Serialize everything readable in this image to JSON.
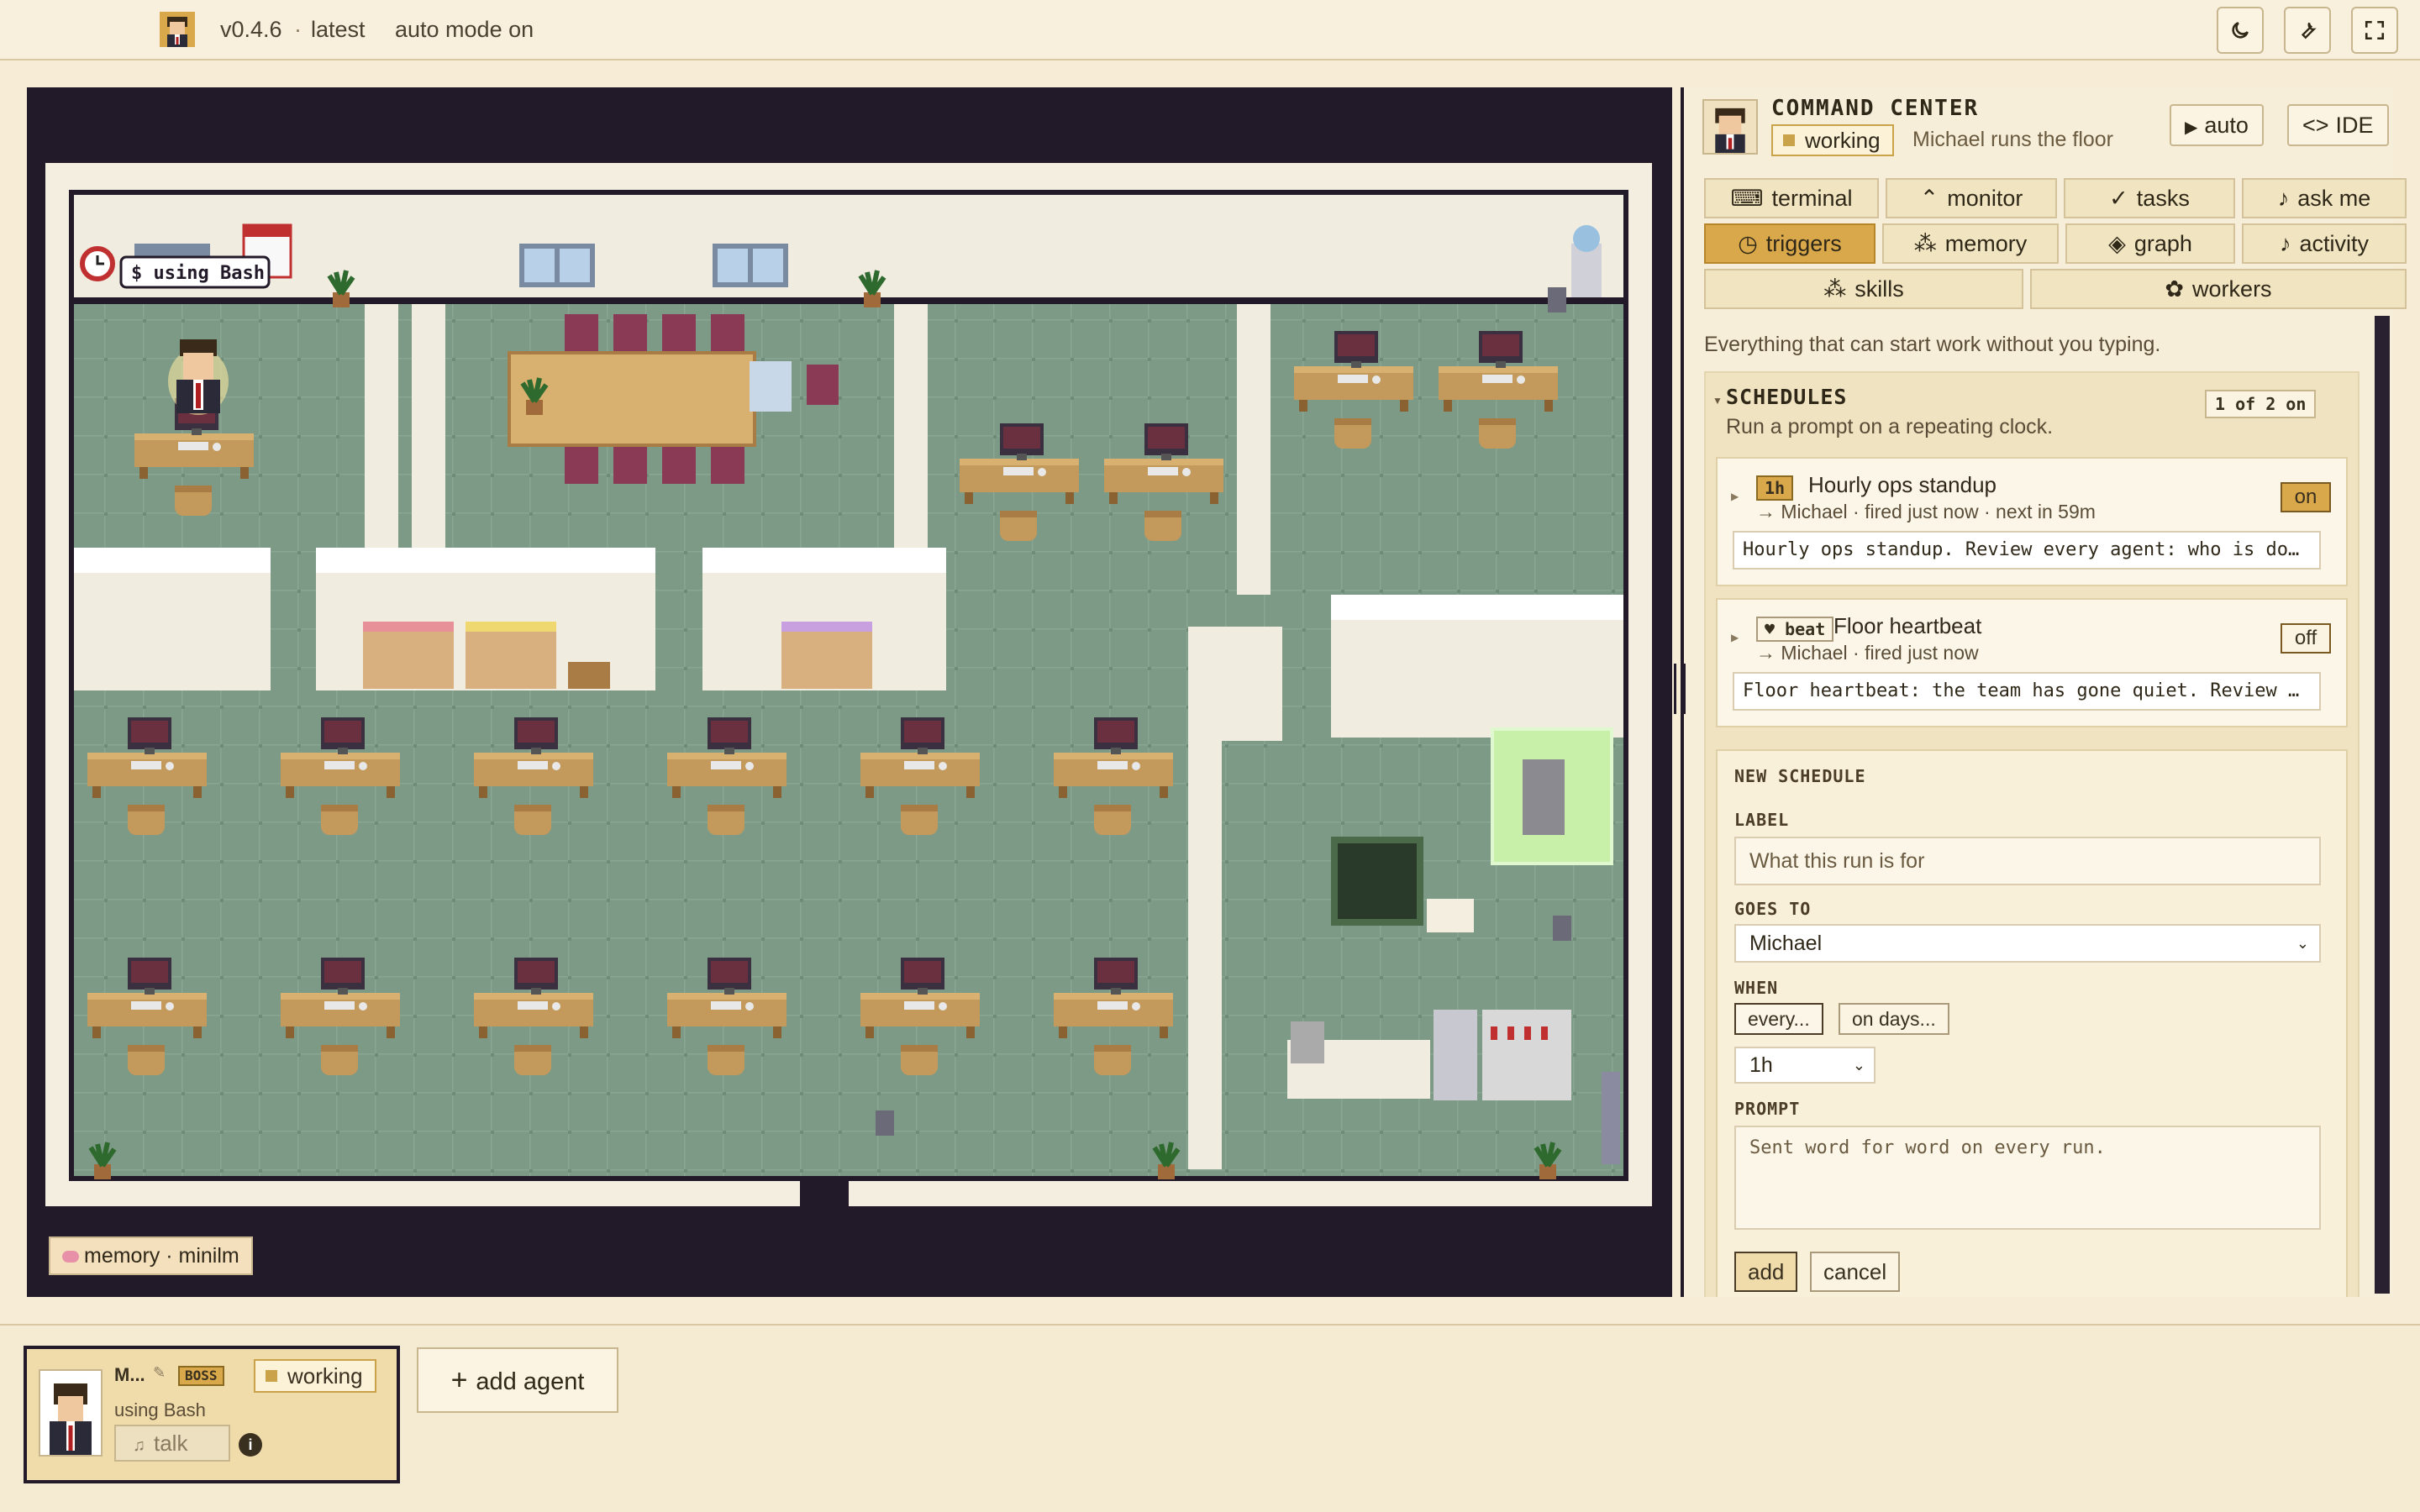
{
  "topbar": {
    "version": "v0.4.6",
    "separator": "·",
    "latest": "latest",
    "mode": "auto mode on"
  },
  "stage": {
    "bubble_text": "$ using Bash",
    "memory_pill": "memory · minilm"
  },
  "panel": {
    "title": "COMMAND CENTER",
    "status": "working",
    "subtitle": "Michael runs the floor",
    "auto_label": "auto",
    "ide_label": "IDE",
    "tabs_row1": [
      "terminal",
      "monitor",
      "tasks",
      "ask me"
    ],
    "tabs_row2": [
      "triggers",
      "memory",
      "graph",
      "activity"
    ],
    "tabs_row3": [
      "skills",
      "workers"
    ],
    "active_tab": "triggers",
    "description": "Everything that can start work without you typing.",
    "schedules": {
      "title": "SCHEDULES",
      "subtitle": "Run a prompt on a repeating clock.",
      "count": "1 of 2 on",
      "items": [
        {
          "badge": "1h",
          "name": "Hourly ops standup",
          "meta": "→ Michael · fired just now · next in 59m",
          "state": "on",
          "prompt": "Hourly ops standup. Review every agent: who is do…"
        },
        {
          "badge": "♥ beat",
          "name": "Floor heartbeat",
          "meta": "→ Michael · fired just now",
          "state": "off",
          "prompt": "Floor heartbeat: the team has gone quiet. Review …"
        }
      ]
    },
    "new_schedule": {
      "title": "NEW SCHEDULE",
      "label_title": "LABEL",
      "label_placeholder": "What this run is for",
      "goes_to_title": "GOES TO",
      "goes_to_value": "Michael",
      "when_title": "WHEN",
      "when_every": "every...",
      "when_days": "on days...",
      "interval": "1h",
      "prompt_title": "PROMPT",
      "prompt_placeholder": "Sent word for word on every run.",
      "add_label": "add",
      "cancel_label": "cancel"
    }
  },
  "bottom": {
    "agent_name": "M...",
    "agent_role": "BOSS",
    "agent_status": "working",
    "agent_activity": "using Bash",
    "talk_label": "talk",
    "add_agent_label": "add agent"
  },
  "colors": {
    "accent": "#d9a84a",
    "floor": "#7d9a86",
    "frame": "#231a29",
    "panel_bg": "#f6eed8"
  }
}
